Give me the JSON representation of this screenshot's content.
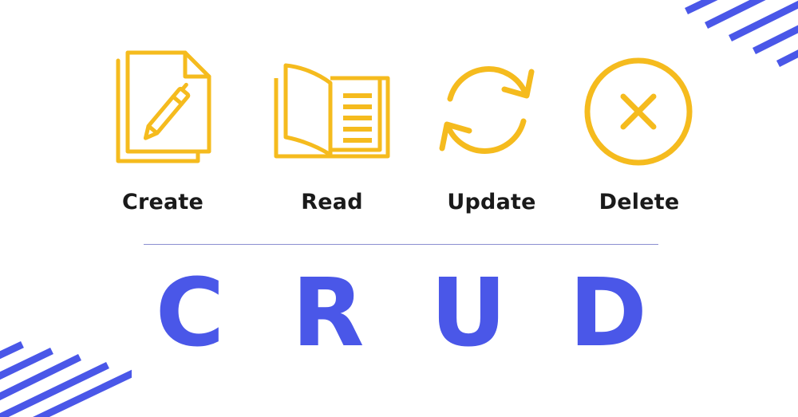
{
  "colors": {
    "icon": "#F5BB1E",
    "acronym": "#4A57E8",
    "label": "#1A1A1A",
    "divider": "#8B8FD0",
    "stripes": "#4A57E8"
  },
  "operations": [
    {
      "label": "Create",
      "icon": "document-pen-icon"
    },
    {
      "label": "Read",
      "icon": "open-book-icon"
    },
    {
      "label": "Update",
      "icon": "refresh-arrows-icon"
    },
    {
      "label": "Delete",
      "icon": "circle-x-icon"
    }
  ],
  "acronym": [
    "C",
    "R",
    "U",
    "D"
  ]
}
